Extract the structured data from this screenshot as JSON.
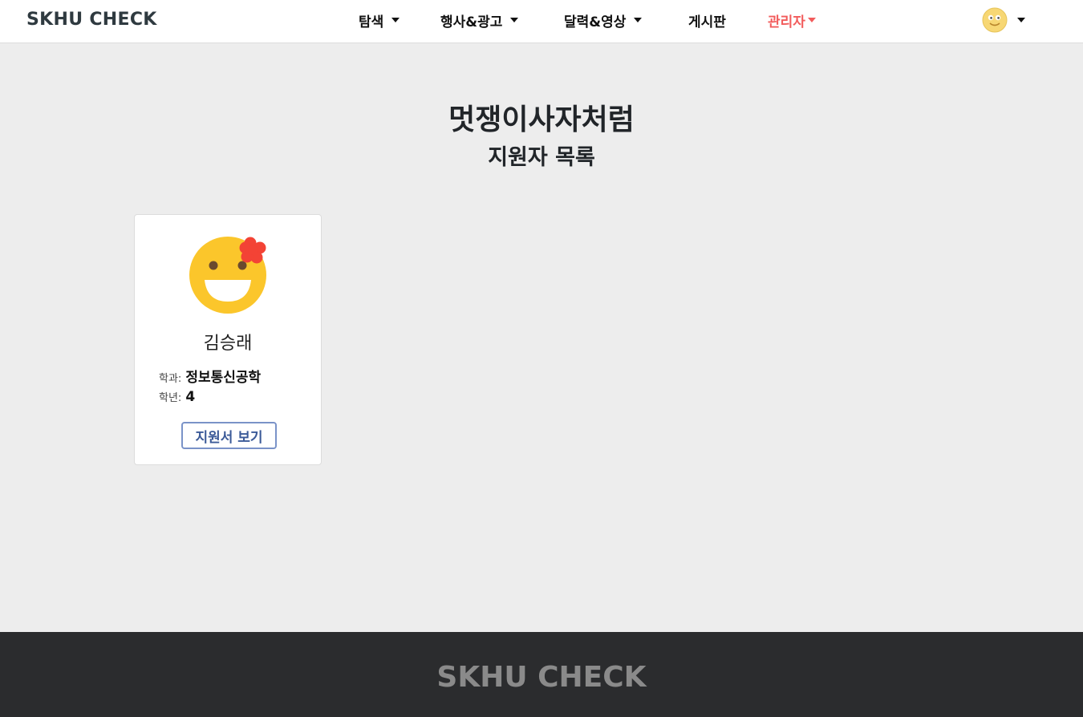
{
  "nav": {
    "brand": "SKHU CHECK",
    "items": [
      {
        "label": "탐색"
      },
      {
        "label": "행사&광고"
      },
      {
        "label": "달력&영상"
      },
      {
        "label": "게시판"
      },
      {
        "label": "관리자"
      }
    ],
    "user_icon": "smiley-face-icon"
  },
  "page": {
    "club_name": "멋쟁이사자처럼",
    "subtitle": "지원자 목록"
  },
  "applicants": [
    {
      "name": "김승래",
      "dept_label": "학과:",
      "dept_value": "정보통신공학",
      "year_label": "학년:",
      "year_value": "4",
      "button_label": "지원서 보기",
      "avatar_icon": "grinning-face-with-flower-icon"
    }
  ],
  "footer": {
    "brand": "SKHU CHECK"
  },
  "colors": {
    "accent_admin": "#f25c5c",
    "button_border": "#7a93c8",
    "footer_bg": "#2b2c2e",
    "page_bg": "#ededed"
  }
}
